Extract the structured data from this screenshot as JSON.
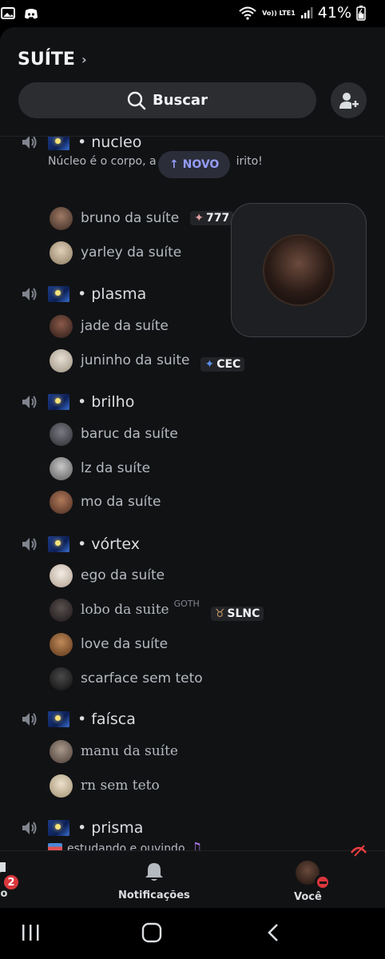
{
  "status_bar": {
    "network": "Vo)) LTE1",
    "battery": "41%"
  },
  "server": {
    "name": "SUÍTE"
  },
  "search": {
    "label": "Buscar"
  },
  "new_pill": "↑ NOVO",
  "channels": [
    {
      "name": "• nucleo",
      "status": "Núcleo é o corpo, a",
      "status_tail": "irito!",
      "members": [
        {
          "name": "bruno da suíte",
          "tag": "777",
          "avatar": "#8a6a5a"
        },
        {
          "name": "yarley da suíte",
          "avatar": "#c8b59a"
        }
      ]
    },
    {
      "name": "• plasma",
      "members": [
        {
          "name": "jade da suíte",
          "avatar": "#6a4a40"
        },
        {
          "name": "juninho da suite",
          "tag": "CEC",
          "avatar": "#d0c7b8"
        }
      ]
    },
    {
      "name": "• brilho",
      "members": [
        {
          "name": "baruc da suíte",
          "avatar": "#4a4a52"
        },
        {
          "name": "lz da suíte",
          "avatar": "#9a9a9a"
        },
        {
          "name": "mo da suíte",
          "avatar": "#7a5240"
        }
      ]
    },
    {
      "name": "• vórtex",
      "members": [
        {
          "name": "ego da suíte",
          "avatar": "#e8e0d8"
        },
        {
          "name": "lobo da suite",
          "sup": "GOTH",
          "tag": "SLNC",
          "avatar": "#3a3434"
        },
        {
          "name": "love da suíte",
          "avatar": "#b07a4a"
        },
        {
          "name": "scarface sem teto",
          "avatar": "#2a2a2a"
        }
      ]
    },
    {
      "name": "• faísca",
      "members": [
        {
          "name": "manu da suíte",
          "avatar": "#8a7a70"
        },
        {
          "name": "rn sem teto",
          "avatar": "#d8c8b0"
        }
      ]
    },
    {
      "name": "• prisma",
      "status": "estudando e ouvindo"
    }
  ],
  "bottom_nav": {
    "left_label": "io",
    "left_badge": "2",
    "notifications": "Notificações",
    "you": "Você"
  },
  "colors": {
    "accent": "#949cf7",
    "danger": "#da373c",
    "bg": "#111214"
  }
}
